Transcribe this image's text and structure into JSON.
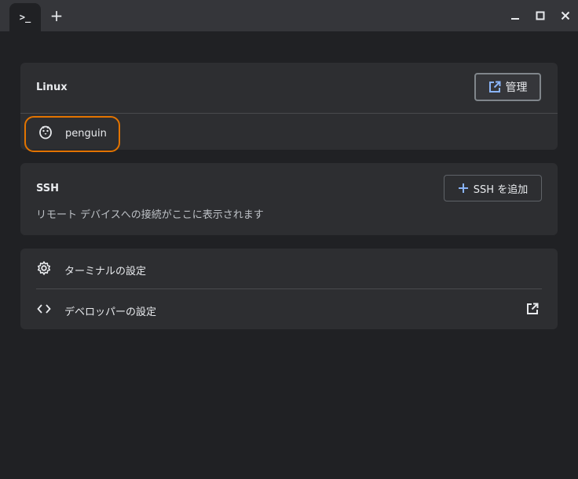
{
  "titlebar": {
    "tab_label": ">_",
    "new_tab_label": "+",
    "icons": {
      "minimize": "minimize-icon",
      "maximize": "maximize-icon",
      "close": "close-icon"
    }
  },
  "linux": {
    "title": "Linux",
    "manage_label": "管理",
    "container_name": "penguin",
    "accent": "#e37400"
  },
  "ssh": {
    "title": "SSH",
    "add_label": "SSH を追加",
    "description": "リモート デバイスへの接続がここに表示されます"
  },
  "settings": {
    "terminal_label": "ターミナルの設定",
    "developer_label": "デベロッパーの設定"
  }
}
